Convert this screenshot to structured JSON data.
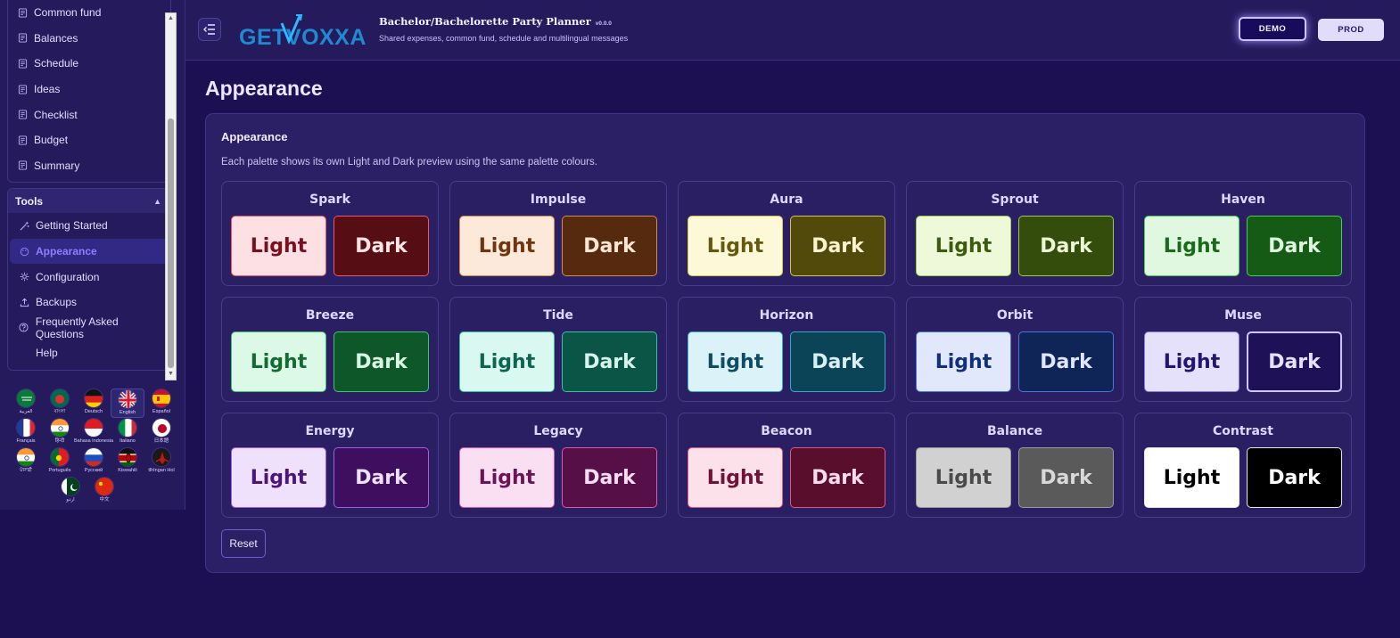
{
  "header": {
    "logo_text": "GETVOXXA",
    "title": "Bachelor/Bachelorette Party Planner",
    "version": "v0.0.0",
    "subtitle": "Shared expenses, common fund, schedule and multilingual messages",
    "env_demo": "DEMO",
    "env_prod": "PROD"
  },
  "sidebar": {
    "items": [
      {
        "label": "Common fund",
        "icon": "page-icon"
      },
      {
        "label": "Balances",
        "icon": "page-icon"
      },
      {
        "label": "Schedule",
        "icon": "page-icon"
      },
      {
        "label": "Ideas",
        "icon": "page-icon"
      },
      {
        "label": "Checklist",
        "icon": "page-icon"
      },
      {
        "label": "Budget",
        "icon": "page-icon"
      },
      {
        "label": "Summary",
        "icon": "page-icon"
      }
    ],
    "tools": {
      "label": "Tools",
      "items": [
        {
          "label": "Getting Started",
          "icon": "wand-icon"
        },
        {
          "label": "Appearance",
          "icon": "palette-icon"
        },
        {
          "label": "Configuration",
          "icon": "gear-icon"
        },
        {
          "label": "Backups",
          "icon": "upload-icon"
        },
        {
          "label": "Frequently Asked Questions",
          "icon": "question-icon"
        },
        {
          "label": "Help",
          "icon": ""
        }
      ]
    },
    "languages": [
      {
        "label": "العربية",
        "flag": "sa"
      },
      {
        "label": "বাংলা",
        "flag": "bd"
      },
      {
        "label": "Deutsch",
        "flag": "de"
      },
      {
        "label": "English",
        "flag": "gb"
      },
      {
        "label": "Español",
        "flag": "es"
      },
      {
        "label": "Français",
        "flag": "fr"
      },
      {
        "label": "हिन्दी",
        "flag": "in"
      },
      {
        "label": "Bahasa Indonesia",
        "flag": "id"
      },
      {
        "label": "Italiano",
        "flag": "it"
      },
      {
        "label": "日本語",
        "flag": "jp"
      },
      {
        "label": "ਪੰਜਾਬੀ",
        "flag": "in"
      },
      {
        "label": "Português",
        "flag": "pt"
      },
      {
        "label": "Русский",
        "flag": "ru"
      },
      {
        "label": "Kiswahili",
        "flag": "ke"
      },
      {
        "label": "tlhIngan Hol",
        "flag": "kl"
      },
      {
        "label": "اردو",
        "flag": "pk"
      },
      {
        "label": "中文",
        "flag": "cn"
      }
    ]
  },
  "main": {
    "page_title": "Appearance",
    "panel_title": "Appearance",
    "panel_desc": "Each palette shows its own Light and Dark preview using the same palette colours.",
    "light_label": "Light",
    "dark_label": "Dark",
    "reset_label": "Reset",
    "palettes": [
      {
        "name": "Spark",
        "light_bg": "#fde0e4",
        "light_fg": "#7a0f1f",
        "dark_bg": "#560d14",
        "dark_fg": "#fbe3e6",
        "border": "#e85a6a"
      },
      {
        "name": "Impulse",
        "light_bg": "#fde9d9",
        "light_fg": "#6e3510",
        "dark_bg": "#552a0e",
        "dark_fg": "#fbe5d4",
        "border": "#d98a4e"
      },
      {
        "name": "Aura",
        "light_bg": "#fdf8d8",
        "light_fg": "#66580f",
        "dark_bg": "#514a0a",
        "dark_fg": "#fbf3cf",
        "border": "#d8c24e"
      },
      {
        "name": "Sprout",
        "light_bg": "#eef9da",
        "light_fg": "#3d5a0f",
        "dark_bg": "#354d0c",
        "dark_fg": "#eaf6d4",
        "border": "#9fcc4e"
      },
      {
        "name": "Haven",
        "light_bg": "#e0f8e0",
        "light_fg": "#1a6a1a",
        "dark_bg": "#155a15",
        "dark_fg": "#dff5df",
        "border": "#4ecc5a"
      },
      {
        "name": "Breeze",
        "light_bg": "#dcf8e6",
        "light_fg": "#146a33",
        "dark_bg": "#0e5728",
        "dark_fg": "#d9f5e3",
        "border": "#3fc472"
      },
      {
        "name": "Tide",
        "light_bg": "#d9f8f0",
        "light_fg": "#0f6650",
        "dark_bg": "#0a5546",
        "dark_fg": "#d6f4ec",
        "border": "#36c2a0"
      },
      {
        "name": "Horizon",
        "light_bg": "#dcf2f9",
        "light_fg": "#0f4d66",
        "dark_bg": "#0b4456",
        "dark_fg": "#d8eff6",
        "border": "#3aa9cf"
      },
      {
        "name": "Orbit",
        "light_bg": "#e1e8fb",
        "light_fg": "#12307a",
        "dark_bg": "#0f2558",
        "dark_fg": "#dfe6fa",
        "border": "#4a74e0"
      },
      {
        "name": "Muse",
        "light_bg": "#e6e1fb",
        "light_fg": "#241670",
        "dark_bg": "#1e1158",
        "dark_fg": "#e6e0fb",
        "border": "#8a76e8"
      },
      {
        "name": "Energy",
        "light_bg": "#efe0fb",
        "light_fg": "#4a1677",
        "dark_bg": "#3d0f5e",
        "dark_fg": "#eedffa",
        "border": "#a45ee0"
      },
      {
        "name": "Legacy",
        "light_bg": "#fadff3",
        "light_fg": "#6b1557",
        "dark_bg": "#560f47",
        "dark_fg": "#f8dcf1",
        "border": "#d35cb4"
      },
      {
        "name": "Beacon",
        "light_bg": "#fce0ea",
        "light_fg": "#701336",
        "dark_bg": "#590e2c",
        "dark_fg": "#fadde8",
        "border": "#dd5a86"
      },
      {
        "name": "Balance",
        "light_bg": "#d1d1d1",
        "light_fg": "#4a4a4a",
        "dark_bg": "#5a5a5a",
        "dark_fg": "#d8d8d8",
        "border": "#9a9a9a"
      },
      {
        "name": "Contrast",
        "light_bg": "#ffffff",
        "light_fg": "#000000",
        "dark_bg": "#000000",
        "dark_fg": "#ffffff",
        "border": "#e6e6e6"
      }
    ],
    "selected": {
      "palette": "Muse",
      "mode": "dark"
    }
  }
}
